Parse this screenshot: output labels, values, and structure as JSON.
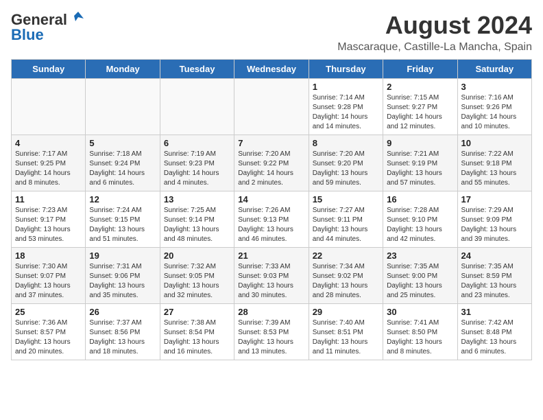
{
  "header": {
    "logo_general": "General",
    "logo_blue": "Blue",
    "month_year": "August 2024",
    "location": "Mascaraque, Castille-La Mancha, Spain"
  },
  "columns": [
    "Sunday",
    "Monday",
    "Tuesday",
    "Wednesday",
    "Thursday",
    "Friday",
    "Saturday"
  ],
  "weeks": [
    [
      {
        "day": "",
        "info": ""
      },
      {
        "day": "",
        "info": ""
      },
      {
        "day": "",
        "info": ""
      },
      {
        "day": "",
        "info": ""
      },
      {
        "day": "1",
        "info": "Sunrise: 7:14 AM\nSunset: 9:28 PM\nDaylight: 14 hours\nand 14 minutes."
      },
      {
        "day": "2",
        "info": "Sunrise: 7:15 AM\nSunset: 9:27 PM\nDaylight: 14 hours\nand 12 minutes."
      },
      {
        "day": "3",
        "info": "Sunrise: 7:16 AM\nSunset: 9:26 PM\nDaylight: 14 hours\nand 10 minutes."
      }
    ],
    [
      {
        "day": "4",
        "info": "Sunrise: 7:17 AM\nSunset: 9:25 PM\nDaylight: 14 hours\nand 8 minutes."
      },
      {
        "day": "5",
        "info": "Sunrise: 7:18 AM\nSunset: 9:24 PM\nDaylight: 14 hours\nand 6 minutes."
      },
      {
        "day": "6",
        "info": "Sunrise: 7:19 AM\nSunset: 9:23 PM\nDaylight: 14 hours\nand 4 minutes."
      },
      {
        "day": "7",
        "info": "Sunrise: 7:20 AM\nSunset: 9:22 PM\nDaylight: 14 hours\nand 2 minutes."
      },
      {
        "day": "8",
        "info": "Sunrise: 7:20 AM\nSunset: 9:20 PM\nDaylight: 13 hours\nand 59 minutes."
      },
      {
        "day": "9",
        "info": "Sunrise: 7:21 AM\nSunset: 9:19 PM\nDaylight: 13 hours\nand 57 minutes."
      },
      {
        "day": "10",
        "info": "Sunrise: 7:22 AM\nSunset: 9:18 PM\nDaylight: 13 hours\nand 55 minutes."
      }
    ],
    [
      {
        "day": "11",
        "info": "Sunrise: 7:23 AM\nSunset: 9:17 PM\nDaylight: 13 hours\nand 53 minutes."
      },
      {
        "day": "12",
        "info": "Sunrise: 7:24 AM\nSunset: 9:15 PM\nDaylight: 13 hours\nand 51 minutes."
      },
      {
        "day": "13",
        "info": "Sunrise: 7:25 AM\nSunset: 9:14 PM\nDaylight: 13 hours\nand 48 minutes."
      },
      {
        "day": "14",
        "info": "Sunrise: 7:26 AM\nSunset: 9:13 PM\nDaylight: 13 hours\nand 46 minutes."
      },
      {
        "day": "15",
        "info": "Sunrise: 7:27 AM\nSunset: 9:11 PM\nDaylight: 13 hours\nand 44 minutes."
      },
      {
        "day": "16",
        "info": "Sunrise: 7:28 AM\nSunset: 9:10 PM\nDaylight: 13 hours\nand 42 minutes."
      },
      {
        "day": "17",
        "info": "Sunrise: 7:29 AM\nSunset: 9:09 PM\nDaylight: 13 hours\nand 39 minutes."
      }
    ],
    [
      {
        "day": "18",
        "info": "Sunrise: 7:30 AM\nSunset: 9:07 PM\nDaylight: 13 hours\nand 37 minutes."
      },
      {
        "day": "19",
        "info": "Sunrise: 7:31 AM\nSunset: 9:06 PM\nDaylight: 13 hours\nand 35 minutes."
      },
      {
        "day": "20",
        "info": "Sunrise: 7:32 AM\nSunset: 9:05 PM\nDaylight: 13 hours\nand 32 minutes."
      },
      {
        "day": "21",
        "info": "Sunrise: 7:33 AM\nSunset: 9:03 PM\nDaylight: 13 hours\nand 30 minutes."
      },
      {
        "day": "22",
        "info": "Sunrise: 7:34 AM\nSunset: 9:02 PM\nDaylight: 13 hours\nand 28 minutes."
      },
      {
        "day": "23",
        "info": "Sunrise: 7:35 AM\nSunset: 9:00 PM\nDaylight: 13 hours\nand 25 minutes."
      },
      {
        "day": "24",
        "info": "Sunrise: 7:35 AM\nSunset: 8:59 PM\nDaylight: 13 hours\nand 23 minutes."
      }
    ],
    [
      {
        "day": "25",
        "info": "Sunrise: 7:36 AM\nSunset: 8:57 PM\nDaylight: 13 hours\nand 20 minutes."
      },
      {
        "day": "26",
        "info": "Sunrise: 7:37 AM\nSunset: 8:56 PM\nDaylight: 13 hours\nand 18 minutes."
      },
      {
        "day": "27",
        "info": "Sunrise: 7:38 AM\nSunset: 8:54 PM\nDaylight: 13 hours\nand 16 minutes."
      },
      {
        "day": "28",
        "info": "Sunrise: 7:39 AM\nSunset: 8:53 PM\nDaylight: 13 hours\nand 13 minutes."
      },
      {
        "day": "29",
        "info": "Sunrise: 7:40 AM\nSunset: 8:51 PM\nDaylight: 13 hours\nand 11 minutes."
      },
      {
        "day": "30",
        "info": "Sunrise: 7:41 AM\nSunset: 8:50 PM\nDaylight: 13 hours\nand 8 minutes."
      },
      {
        "day": "31",
        "info": "Sunrise: 7:42 AM\nSunset: 8:48 PM\nDaylight: 13 hours\nand 6 minutes."
      }
    ]
  ]
}
